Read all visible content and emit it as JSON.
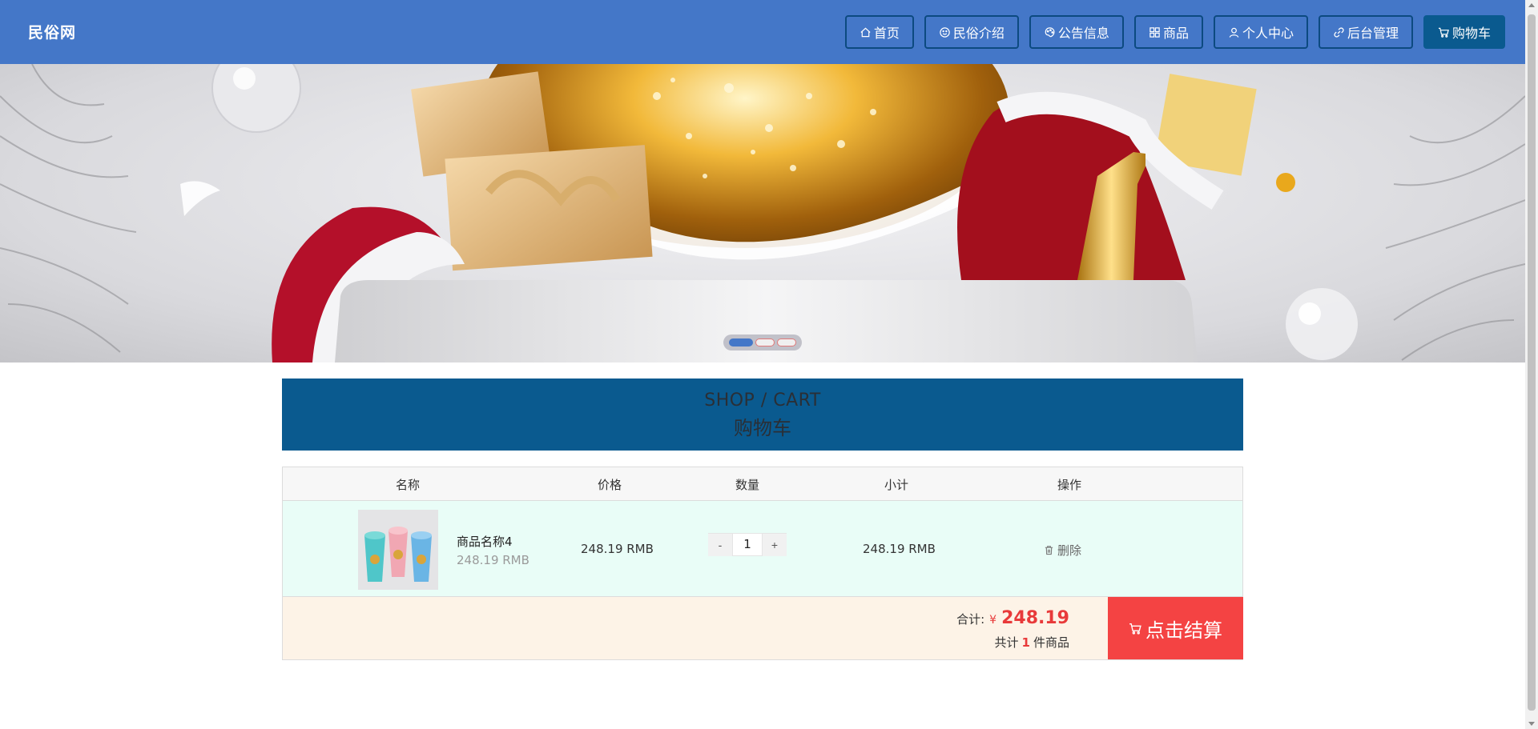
{
  "site": {
    "brand": "民俗网"
  },
  "nav": [
    {
      "label": "首页",
      "icon": "home-icon"
    },
    {
      "label": "民俗介绍",
      "icon": "smile-icon"
    },
    {
      "label": "公告信息",
      "icon": "palette-icon"
    },
    {
      "label": "商品",
      "icon": "grid-icon"
    },
    {
      "label": "个人中心",
      "icon": "user-icon"
    },
    {
      "label": "后台管理",
      "icon": "link-icon"
    },
    {
      "label": "购物车",
      "icon": "cart-icon",
      "active": true
    }
  ],
  "banner": {
    "slides": 3,
    "active_slide": 1
  },
  "section": {
    "title_en": "SHOP / CART",
    "title_cn": "购物车"
  },
  "cart": {
    "columns": {
      "name": "名称",
      "price": "价格",
      "qty": "数量",
      "subtotal": "小计",
      "action": "操作"
    },
    "items": [
      {
        "name": "商品名称4",
        "unit_price": "248.19 RMB",
        "price": "248.19 RMB",
        "qty": "1",
        "subtotal": "248.19 RMB",
        "delete_label": "删除",
        "qty_minus": "-",
        "qty_plus": "+"
      }
    ],
    "total_label": "合计:",
    "currency": "¥",
    "total": "248.19",
    "count_prefix": "共计",
    "count": "1",
    "count_suffix": "件商品",
    "checkout_label": "点击结算"
  },
  "colors": {
    "header": "#4477c8",
    "section": "#0a5a8f",
    "checkout": "#f44343",
    "row": "#e9fdf7",
    "footer": "#fdf3e7"
  }
}
